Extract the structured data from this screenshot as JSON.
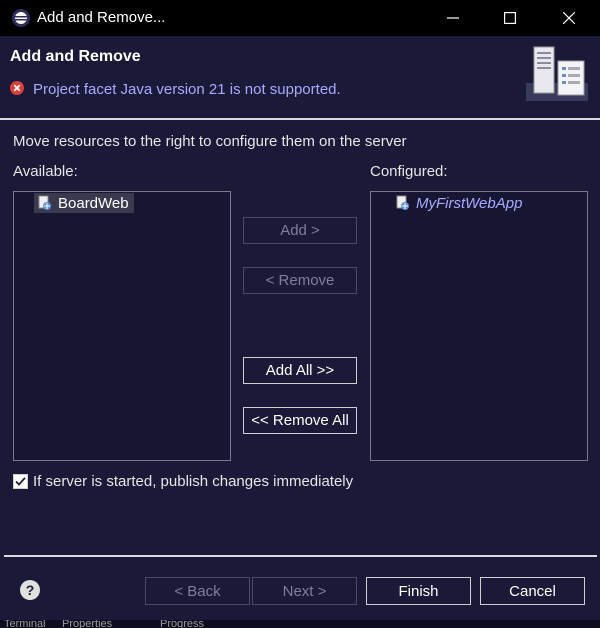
{
  "window": {
    "title": "Add and Remove..."
  },
  "banner": {
    "title": "Add and Remove",
    "error_message": "Project facet Java version 21 is not supported."
  },
  "main": {
    "description": "Move resources to the right to configure them on the server",
    "available_label": "Available:",
    "configured_label": "Configured:",
    "available_items": [
      {
        "label": "BoardWeb",
        "selected": true
      }
    ],
    "configured_items": [
      {
        "label": "MyFirstWebApp",
        "selected": false
      }
    ]
  },
  "buttons": {
    "add": "Add >",
    "remove": "< Remove",
    "add_all": "Add All >>",
    "remove_all": "<< Remove All"
  },
  "publish": {
    "label": "If server is started, publish changes immediately",
    "checked": true
  },
  "footer": {
    "back": "< Back",
    "next": "Next >",
    "finish": "Finish",
    "cancel": "Cancel"
  },
  "background_views": [
    "Terminal",
    "Properties",
    "Progress"
  ],
  "colors": {
    "background": "#1a1a38",
    "titlebar": "#000000",
    "error": "#d9403a",
    "link_text": "#a9a9ff",
    "disabled_text": "#7f7f98"
  }
}
